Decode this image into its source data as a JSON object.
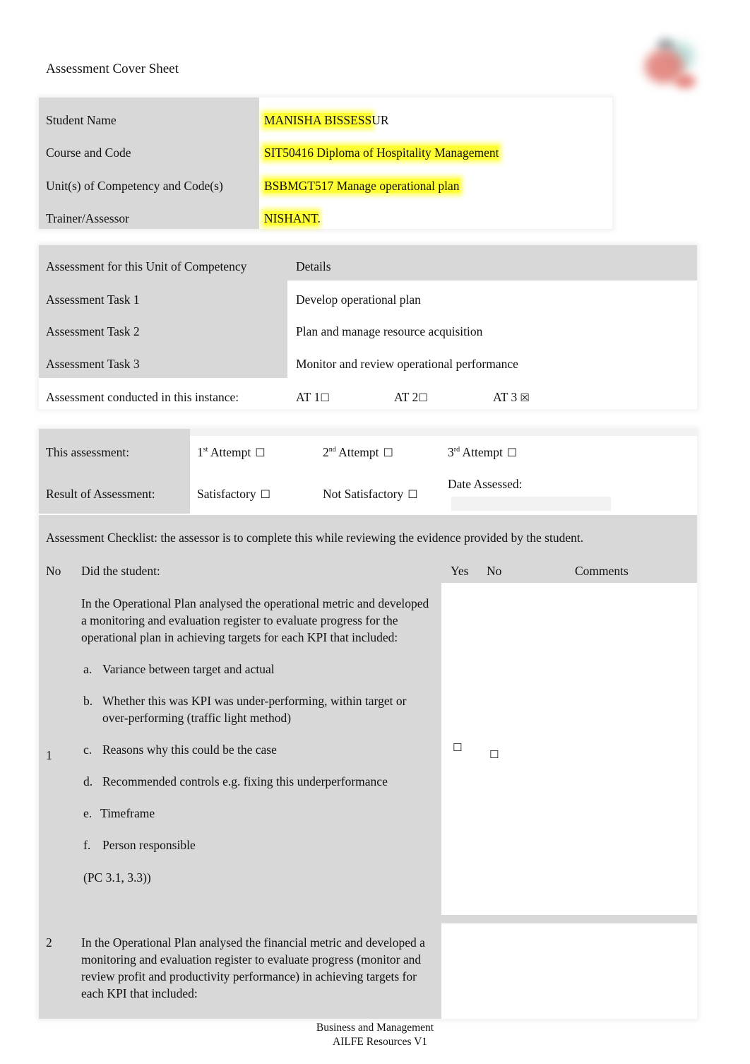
{
  "document": {
    "title": "Assessment Cover Sheet",
    "logo_icon": "organization-logo"
  },
  "student_info": [
    {
      "label": "Student Name",
      "value_highlighted": "MANISHA BISSESS",
      "value_rest": "UR"
    },
    {
      "label": "Course and Code",
      "value_highlighted": "SIT50416 Diploma of Hospitality Management",
      "value_rest": ""
    },
    {
      "label": "Unit(s) of Competency and Code(s)",
      "value_highlighted": "BSBMGT517 Manage operational plan",
      "value_rest": ""
    },
    {
      "label": "Trainer/Assessor",
      "value_highlighted": "NISHANT",
      "value_rest": "."
    }
  ],
  "tasks": {
    "header": {
      "left": "Assessment for this Unit of Competency",
      "right": "Details"
    },
    "rows": [
      {
        "label": "Assessment Task 1",
        "detail": "Develop operational plan"
      },
      {
        "label": "Assessment Task 2",
        "detail": "Plan and manage resource acquisition"
      },
      {
        "label": "Assessment Task 3",
        "detail": "Monitor and review operational performance"
      }
    ],
    "instance_label": "Assessment conducted in this instance:",
    "instances": [
      {
        "label": "AT 1",
        "box": "☐",
        "checked": false
      },
      {
        "label": "AT 2",
        "box": "☐",
        "checked": false
      },
      {
        "label": "AT 3",
        "box": "☒",
        "checked": true
      }
    ]
  },
  "attempt": {
    "label": "This assessment:",
    "options": [
      {
        "num": "1",
        "sup": "st",
        "text": "Attempt",
        "box": "☐",
        "checked": false
      },
      {
        "num": "2",
        "sup": "nd",
        "text": "Attempt",
        "box": "☐",
        "checked": false
      },
      {
        "num": "3",
        "sup": "rd",
        "text": "Attempt",
        "box": "☐",
        "checked": false
      }
    ]
  },
  "result": {
    "label": "Result of Assessment:",
    "options": [
      {
        "text": "Satisfactory",
        "box": "☐",
        "checked": false
      },
      {
        "text": "Not Satisfactory",
        "box": "☐",
        "checked": false
      }
    ],
    "date_label": "Date Assessed:",
    "date_value": ""
  },
  "checklist": {
    "intro": "Assessment Checklist: the assessor is to complete this while reviewing the evidence provided by the student.",
    "headers": {
      "no": "No",
      "question": "Did the student:",
      "yes": "Yes",
      "no_col": "No",
      "comments": "Comments"
    },
    "items": [
      {
        "no": "1",
        "question": "In the Operational Plan analysed the  operational  metric and developed a monitoring and evaluation register to evaluate progress for the operational plan in achieving targets for each KPI that included:",
        "subitems": [
          {
            "label": "a.",
            "text": "Variance between target and actual"
          },
          {
            "label": "b.",
            "text": "Whether this was KPI was under-performing, within target or over-performing (traffic light method)"
          },
          {
            "label": "c.",
            "text": "Reasons why this could be the case"
          },
          {
            "label": "d.",
            "text": "Recommended controls e.g. fixing this underperformance"
          },
          {
            "label": "e.",
            "text": "Timeframe"
          },
          {
            "label": "f.",
            "text": "Person responsible"
          }
        ],
        "reference": "(PC 3.1, 3.3))",
        "yes_box": "☐",
        "no_box": "☐",
        "yes_checked": false,
        "no_checked": false,
        "comments": ""
      },
      {
        "no": "2",
        "question": "In the Operational Plan analysed the  financial metric and developed a monitoring and evaluation register to evaluate progress (monitor and review profit and productivity performance) in achieving targets for each KPI that included:",
        "comments": ""
      }
    ]
  },
  "footer": {
    "line1": "Business and Management",
    "line2": "AILFE Resources V1"
  }
}
